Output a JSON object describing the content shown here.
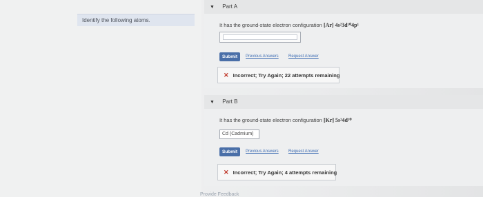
{
  "instruction": "Identify the following atoms.",
  "parts": [
    {
      "title": "Part A",
      "question_prefix": "It has the ground-state electron configuration",
      "configuration": "[Ar] 4s²3d¹⁰4p¹",
      "answer_value": "",
      "submit_label": "Submit",
      "previous_answers_label": "Previous Answers",
      "request_answer_label": "Request Answer",
      "feedback": "Incorrect; Try Again; 22 attempts remaining"
    },
    {
      "title": "Part B",
      "question_prefix": "It has the ground-state electron configuration",
      "configuration": "[Kr] 5s²4d¹⁰",
      "answer_value": "Cd (Cadmium)",
      "submit_label": "Submit",
      "previous_answers_label": "Previous Answers",
      "request_answer_label": "Request Answer",
      "feedback": "Incorrect; Try Again; 4 attempts remaining"
    }
  ],
  "footer": "Provide Feedback",
  "colors": {
    "submit": "#4a6fa8",
    "link": "#3d6cb3",
    "incorrect": "#c0392b"
  },
  "icons": {
    "collapse": "caret-down-icon",
    "incorrect": "x-mark-icon"
  }
}
